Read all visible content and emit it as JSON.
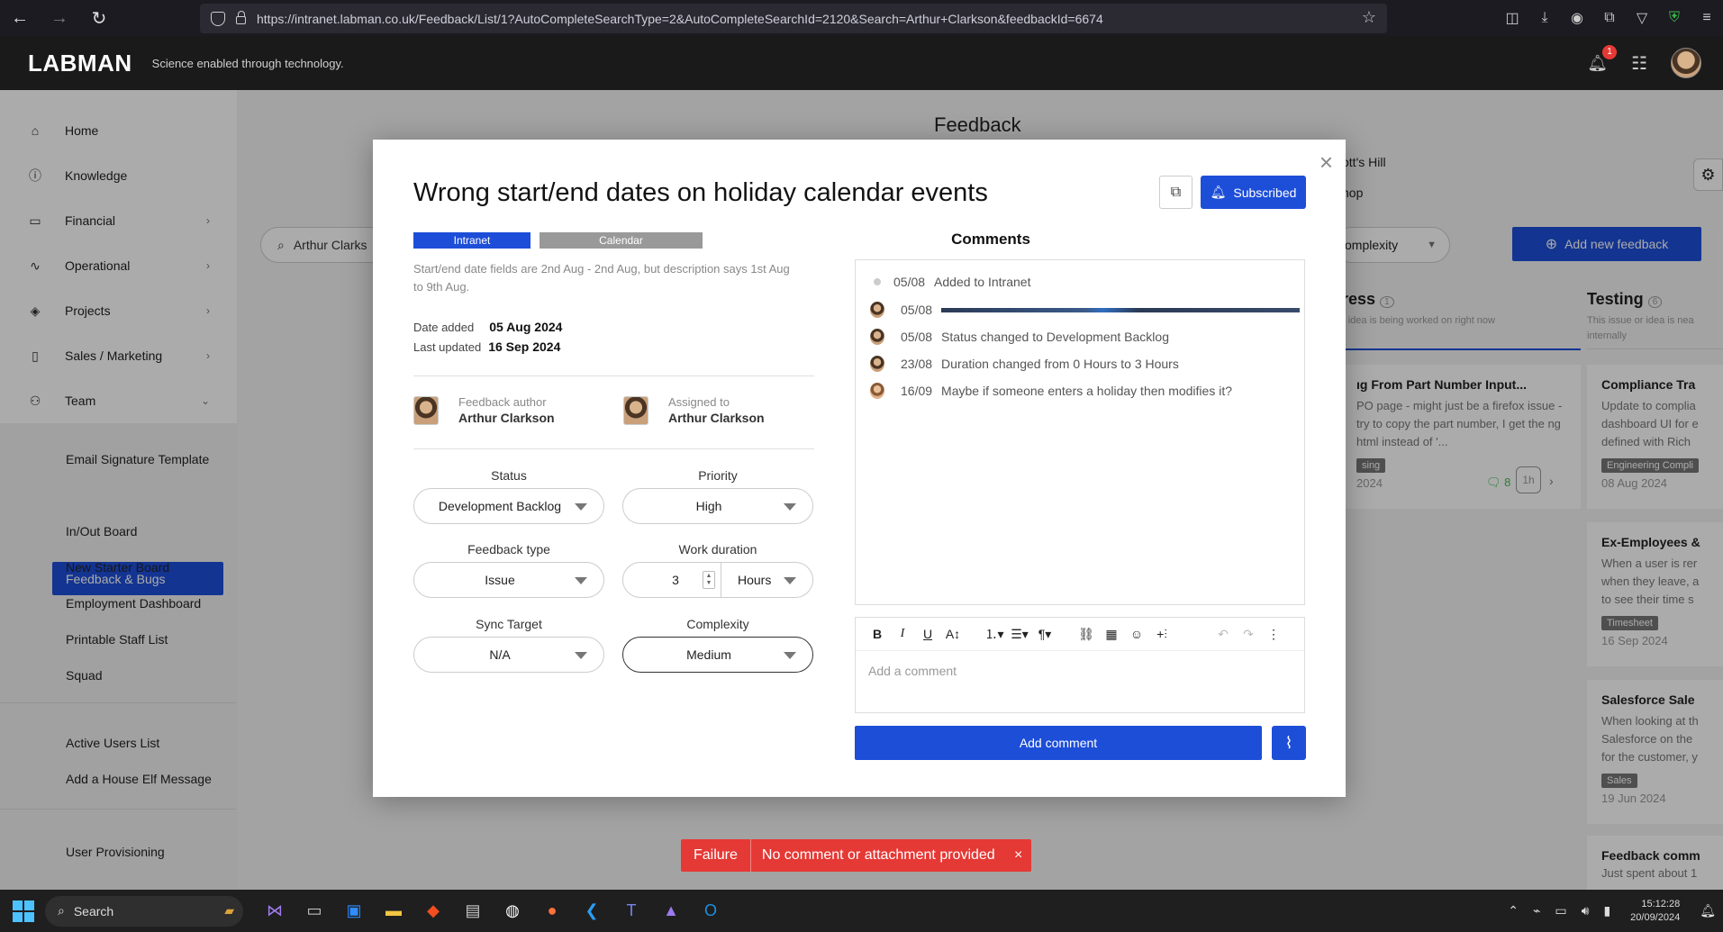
{
  "browser": {
    "url": "https://intranet.labman.co.uk/Feedback/List/1?AutoCompleteSearchType=2&AutoCompleteSearchId=2120&Search=Arthur+Clarkson&feedbackId=6674"
  },
  "header": {
    "logo": "LABMAN",
    "tagline": "Science enabled through technology.",
    "notification_count": "1"
  },
  "sidebar": {
    "items": [
      {
        "label": "Home"
      },
      {
        "label": "Knowledge"
      },
      {
        "label": "Financial"
      },
      {
        "label": "Operational"
      },
      {
        "label": "Projects"
      },
      {
        "label": "Sales / Marketing"
      },
      {
        "label": "Team"
      }
    ],
    "team_sub": [
      {
        "label": "Email Signature Template"
      },
      {
        "label": "Feedback & Bugs"
      },
      {
        "label": "In/Out Board"
      },
      {
        "label": "New Starter Board"
      },
      {
        "label": "Employment Dashboard"
      },
      {
        "label": "Printable Staff List"
      },
      {
        "label": "Squad"
      }
    ],
    "extra": [
      {
        "label": "Active Users List"
      },
      {
        "label": "Add a House Elf Message"
      },
      {
        "label": "User Provisioning"
      }
    ]
  },
  "background": {
    "page_title": "Feedback",
    "search_value": "Arthur Clarks",
    "loc1": "ott's Hill",
    "loc2": "hop",
    "complexity": "omplexity",
    "add_btn": "Add new feedback",
    "col_progress_title": "ress",
    "col_progress_sub": "r idea is being worked on right now",
    "col_testing_title": "Testing",
    "col_testing_sub": "This issue or idea is nea internally",
    "progress_info_icon": "1",
    "testing_info_icon": "6",
    "card1": {
      "title": "ıg From Part Number Input...",
      "desc": "PO page - might just be a firefox issue - try to copy the part number, I get the ng html instead of '...",
      "tag": "sing",
      "date": "2024",
      "comments": "8",
      "duration": "1h"
    },
    "card2": {
      "title": "Compliance Tra",
      "desc": "Update to complia dashboard UI for e defined with Rich",
      "tag": "Engineering Compli",
      "date": "08 Aug 2024"
    },
    "card3": {
      "title": "Ex-Employees &",
      "desc": "When a user is rer when they leave, a to see their time s",
      "tag": "Timesheet",
      "date": "16 Sep 2024"
    },
    "card4": {
      "title": "Salesforce Sale",
      "desc": "When looking at th Salesforce on the for the customer, y",
      "tag": "Sales",
      "date": "19 Jun 2024"
    },
    "card5": {
      "title": "Feedback comm",
      "desc": "Just spent about 1"
    }
  },
  "modal": {
    "title": "Wrong start/end dates on holiday calendar events",
    "subscribed": "Subscribed",
    "tags": [
      "Intranet",
      "Calendar"
    ],
    "description": "Start/end date fields are 2nd Aug - 2nd Aug, but description says 1st Aug to 9th Aug.",
    "date_added_label": "Date added",
    "date_added": "05 Aug 2024",
    "last_updated_label": "Last updated",
    "last_updated": "16 Sep 2024",
    "author_label": "Feedback author",
    "author": "Arthur Clarkson",
    "assigned_label": "Assigned to",
    "assigned": "Arthur Clarkson",
    "status_label": "Status",
    "status": "Development Backlog",
    "priority_label": "Priority",
    "priority": "High",
    "type_label": "Feedback type",
    "type": "Issue",
    "duration_label": "Work duration",
    "duration_value": "3",
    "duration_unit": "Hours",
    "sync_label": "Sync Target",
    "sync": "N/A",
    "complexity_label": "Complexity",
    "complexity": "Medium",
    "comments_title": "Comments",
    "comments": [
      {
        "date": "05/08",
        "text": "Added to Intranet"
      },
      {
        "date": "05/08",
        "text": ""
      },
      {
        "date": "05/08",
        "text": "Status changed to Development Backlog"
      },
      {
        "date": "23/08",
        "text": "Duration changed from 0 Hours to 3 Hours"
      },
      {
        "date": "16/09",
        "text": "Maybe if someone enters a holiday then modifies it?"
      }
    ],
    "comment_placeholder": "Add a comment",
    "add_comment": "Add comment"
  },
  "toast": {
    "type": "Failure",
    "message": "No comment or attachment provided"
  },
  "taskbar": {
    "search": "Search",
    "time": "15:12:28",
    "date": "20/09/2024"
  }
}
